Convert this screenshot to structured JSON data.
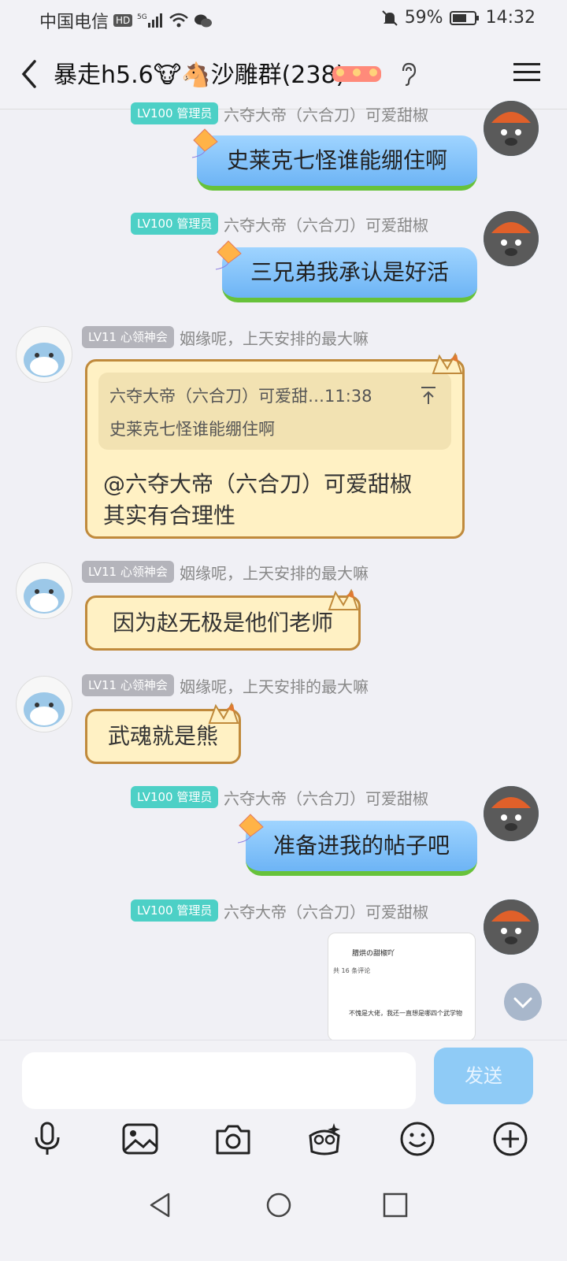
{
  "status": {
    "carrier": "中国电信",
    "hd": "HD",
    "battery": "59%",
    "time": "14:32"
  },
  "header": {
    "title": "暴走h5.6🐮🐴沙雕群(238)"
  },
  "messages": {
    "m1": {
      "badge": "LV100 管理员",
      "nick": "六夺大帝（六合刀）可爱甜椒",
      "text": "史莱克七怪谁能绷住啊"
    },
    "m2": {
      "badge": "LV100 管理员",
      "nick": "六夺大帝（六合刀）可爱甜椒",
      "text": "三兄弟我承认是好活"
    },
    "m3": {
      "badge": "LV11 心领神会",
      "nick": "姻缘呢，上天安排的最大嘛",
      "quote_name": "六夺大帝（六合刀）可爱甜…11:38",
      "quote_text": "史莱克七怪谁能绷住啊",
      "text1": "@六夺大帝（六合刀）可爱甜椒",
      "text2": "其实有合理性"
    },
    "m4": {
      "badge": "LV11 心领神会",
      "nick": "姻缘呢，上天安排的最大嘛",
      "text": "因为赵无极是他们老师"
    },
    "m5": {
      "badge": "LV11 心领神会",
      "nick": "姻缘呢，上天安排的最大嘛",
      "text": "武魂就是熊"
    },
    "m6": {
      "badge": "LV100 管理员",
      "nick": "六夺大帝（六合刀）可爱甜椒",
      "text": "准备进我的帖子吧"
    },
    "m7": {
      "badge": "LV100 管理员",
      "nick": "六夺大帝（六合刀）可爱甜椒",
      "shot_title": "腊烘の甜椒吖",
      "shot_count": "共 16 条评论",
      "shot_line": "不愧是大佬，我还一直想是哪四个武学物"
    }
  },
  "input": {
    "send": "发送"
  }
}
